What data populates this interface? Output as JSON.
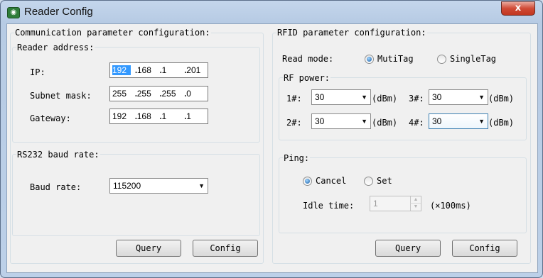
{
  "window": {
    "title": "Reader Config",
    "close_glyph": "x",
    "app_icon_glyph": "◉"
  },
  "comm": {
    "title": "Communication parameter configuration:",
    "reader_address": {
      "title": "Reader address:",
      "ip_label": "IP:",
      "ip": [
        "192",
        "168",
        "1",
        "201"
      ],
      "mask_label": "Subnet mask:",
      "mask": [
        "255",
        "255",
        "255",
        "0"
      ],
      "gateway_label": "Gateway:",
      "gateway": [
        "192",
        "168",
        "1",
        "1"
      ]
    },
    "rs232": {
      "title": "RS232 baud rate:",
      "baud_label": "Baud rate:",
      "baud_value": "115200"
    },
    "query_label": "Query",
    "config_label": "Config"
  },
  "rfid": {
    "title": "RFID parameter configuration:",
    "read_mode_label": "Read mode:",
    "read_mode_options": [
      "MutiTag",
      "SingleTag"
    ],
    "read_mode_selected": "MutiTag",
    "rf_power": {
      "title": "RF power:",
      "unit": "(dBm)",
      "antennas": [
        {
          "label": "1#:",
          "value": "30"
        },
        {
          "label": "3#:",
          "value": "30"
        },
        {
          "label": "2#:",
          "value": "30"
        },
        {
          "label": "4#:",
          "value": "30"
        }
      ]
    },
    "ping": {
      "title": "Ping:",
      "options": [
        "Cancel",
        "Set"
      ],
      "selected": "Cancel",
      "idle_label": "Idle time:",
      "idle_value": "1",
      "idle_unit": "(×100ms)"
    },
    "query_label": "Query",
    "config_label": "Config"
  },
  "colors": {
    "title_bar": "#b9cde6",
    "close_button": "#c94530",
    "selection": "#3399ff",
    "dialog_bg": "#f0f0f0"
  }
}
